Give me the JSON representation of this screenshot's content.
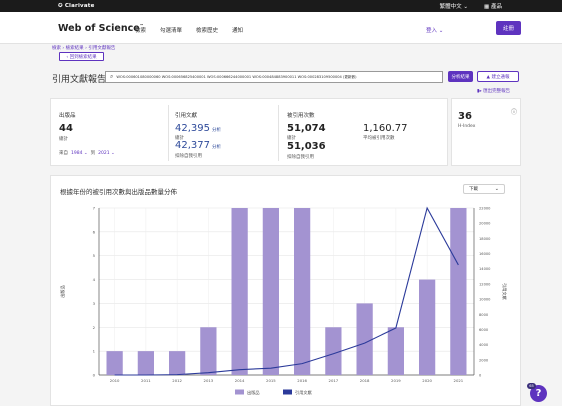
{
  "topbar": {
    "brand": "Clarivate",
    "language": "繁體中文",
    "language_chevron": "⌄",
    "products": "產品"
  },
  "nav": {
    "logo": "Web of Science",
    "logo_mark": "™",
    "links": [
      "檢索",
      "勾選清單",
      "檢索歷史",
      "通知"
    ],
    "login": "登入",
    "register": "註冊"
  },
  "breadcrumb": "檢索 › 檢索結果 › 引用文獻報告",
  "back_label": "‹ 回到檢索結果",
  "page_title": "引用文獻報告",
  "query_text": "WOS:000601080000060 WOS:000656825400001 WOS:000666244000001 WOS:000484883900011 WOS:000283109500004 (更新數)",
  "buttons": {
    "analyze": "分析結果",
    "track": "▲ 建立通報",
    "export": "匯出完整報告"
  },
  "stats": {
    "publications_label": "出版品",
    "publications_value": "44",
    "publications_sub": "總計",
    "from_label": "來自",
    "from_year": "1984",
    "to_label": "到",
    "to_year": "2021",
    "citing_label": "引用文獻",
    "citing_value": "42,395",
    "citing_unit": "分析",
    "citing_sub": "總計",
    "citing_excl_value": "42,377",
    "citing_excl_unit": "分析",
    "citing_excl_sub": "扣除自我引用",
    "times_cited_label": "被引用次數",
    "times_cited_value": "51,074",
    "times_cited_sub": "總計",
    "avg_value": "1,160.77",
    "avg_sub": "平均被引用次數",
    "times_excl_value": "51,036",
    "times_excl_sub": "扣除自我引用",
    "hindex_value": "36",
    "hindex_label": "H-Index",
    "info_icon": "ⓘ"
  },
  "chart_dropdown": "下載",
  "help": {
    "badge": "65",
    "label": "?"
  },
  "accent_color": "#5e33bf",
  "chart_data": {
    "type": "bar",
    "title": "根據年份的被引用次數與出版品數量分佈",
    "categories": [
      "2010",
      "2011",
      "2012",
      "2013",
      "2014",
      "2015",
      "2016",
      "2017",
      "2018",
      "2019",
      "2020",
      "2021"
    ],
    "series": [
      {
        "name": "出版品",
        "type": "bar",
        "axis": "left",
        "color": "#a393d1",
        "values": [
          1,
          1,
          1,
          2,
          7,
          7,
          7,
          2,
          3,
          2,
          4,
          7
        ]
      },
      {
        "name": "引用文獻",
        "type": "line",
        "axis": "right",
        "color": "#2b3a9a",
        "values": [
          0,
          0,
          50,
          300,
          700,
          900,
          1500,
          2800,
          4200,
          6200,
          23000,
          14500
        ]
      }
    ],
    "ylabel": "出版品",
    "y2label": "引用文獻",
    "ylim": [
      0,
      7
    ],
    "y2lim": [
      0,
      22000
    ],
    "yticks": [
      0,
      1,
      2,
      3,
      4,
      5,
      6,
      7
    ],
    "y2ticks": [
      0,
      2000,
      4000,
      6000,
      8000,
      10000,
      12000,
      14000,
      16000,
      18000,
      20000,
      22000
    ],
    "grid": true,
    "legend": "bottom"
  }
}
